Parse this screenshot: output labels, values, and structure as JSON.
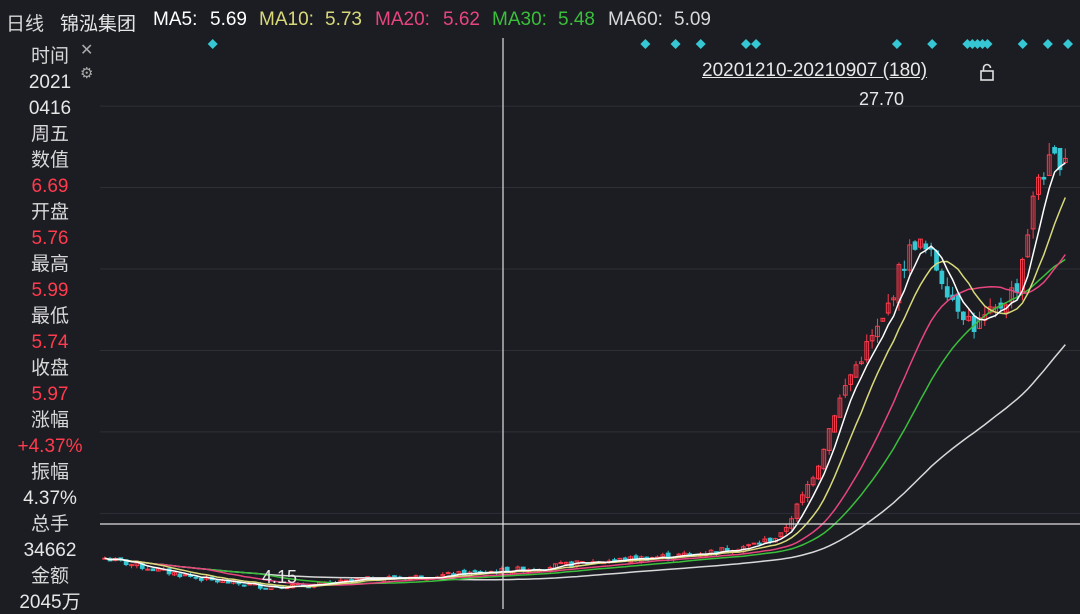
{
  "header": {
    "period": "日线",
    "stock_name": "锦泓集团",
    "ma5_label": "MA5:",
    "ma5_value": "5.69",
    "ma10_label": "MA10:",
    "ma10_value": "5.73",
    "ma20_label": "MA20:",
    "ma20_value": "5.62",
    "ma30_label": "MA30:",
    "ma30_value": "5.48",
    "ma60_label": "MA60:",
    "ma60_value": "5.09"
  },
  "colors": {
    "up": "#ff3b4d",
    "down": "#35c7d3",
    "ma5": "#ffffff",
    "ma10": "#d9d97a",
    "ma20": "#e8457e",
    "ma30": "#3bbf3b",
    "ma60": "#d8d8d8",
    "background": "#1b1d23"
  },
  "icons": {
    "close": "close-icon",
    "settings": "gear-icon",
    "lock": "lock-icon"
  },
  "sidebar": {
    "time_label": "时间",
    "time_year": "2021",
    "time_date": "0416",
    "weekday": "周五",
    "value_label": "数值",
    "value": "6.69",
    "open_label": "开盘",
    "open": "5.76",
    "high_label": "最高",
    "high": "5.99",
    "low_label": "最低",
    "low": "5.74",
    "close_label": "收盘",
    "close": "5.97",
    "change_label": "涨幅",
    "change": "+4.37%",
    "amplitude_label": "振幅",
    "amplitude": "4.37%",
    "volume_label": "总手",
    "volume": "34662",
    "amount_label": "金额",
    "amount": "2045万"
  },
  "range_label": "20201210-20210907 (180)",
  "chart_data": {
    "type": "candlestick",
    "title": "",
    "high_annotation": "27.70",
    "low_annotation": "4.15",
    "crosshair_value": 6.69,
    "ylim": [
      3.5,
      31
    ],
    "n_days": 180,
    "anchors_close": [
      [
        0,
        5.8
      ],
      [
        10,
        5.2
      ],
      [
        20,
        4.7
      ],
      [
        30,
        4.4
      ],
      [
        40,
        4.5
      ],
      [
        50,
        4.8
      ],
      [
        60,
        4.9
      ],
      [
        70,
        5.1
      ],
      [
        80,
        5.3
      ],
      [
        90,
        5.6
      ],
      [
        100,
        5.8
      ],
      [
        110,
        6.0
      ],
      [
        120,
        6.4
      ],
      [
        126,
        6.9
      ],
      [
        130,
        8.8
      ],
      [
        133,
        10.5
      ],
      [
        136,
        13.0
      ],
      [
        139,
        14.8
      ],
      [
        142,
        16.2
      ],
      [
        145,
        17.4
      ],
      [
        148,
        19.8
      ],
      [
        151,
        21.4
      ],
      [
        154,
        20.6
      ],
      [
        158,
        18.6
      ],
      [
        162,
        17.2
      ],
      [
        166,
        17.9
      ],
      [
        170,
        19.2
      ],
      [
        174,
        24.6
      ],
      [
        178,
        25.5
      ],
      [
        182,
        26.3
      ]
    ],
    "ma_values": {
      "MA5": 5.69,
      "MA10": 5.73,
      "MA20": 5.62,
      "MA30": 5.48,
      "MA60": 5.09
    }
  }
}
